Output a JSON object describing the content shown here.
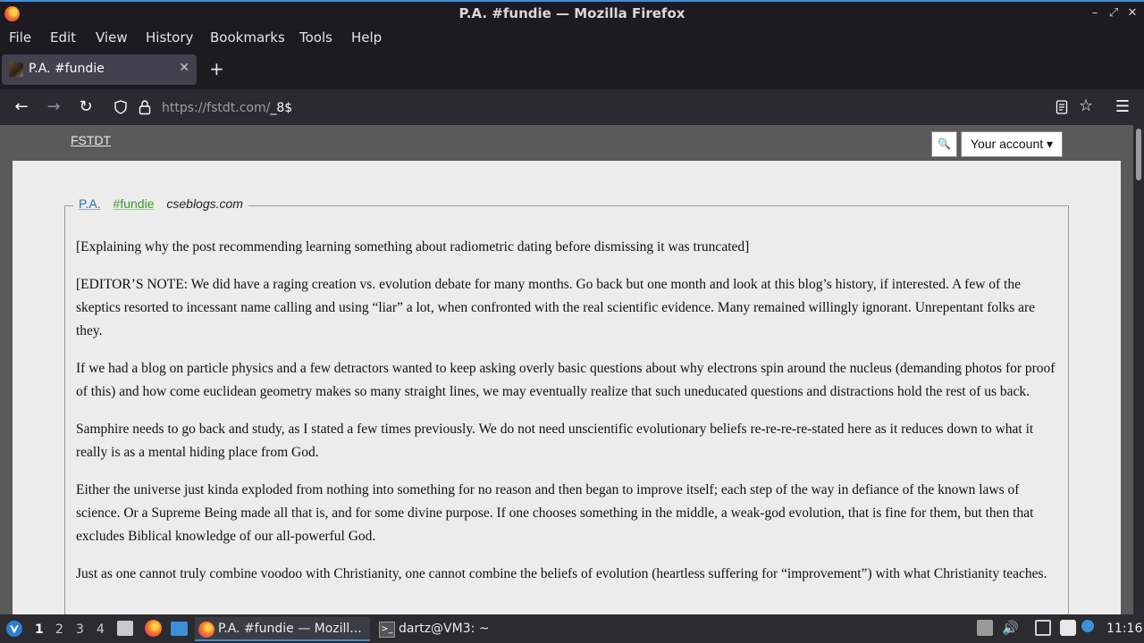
{
  "window": {
    "title": "P.A. #fundie — Mozilla Firefox"
  },
  "menu": [
    "File",
    "Edit",
    "View",
    "History",
    "Bookmarks",
    "Tools",
    "Help"
  ],
  "tab": {
    "title": "P.A. #fundie"
  },
  "url": {
    "host": "https://fstdt.com/",
    "path": "_8$"
  },
  "site": {
    "logo": "FSTDT",
    "account_label": "Your account ▾"
  },
  "quote": {
    "author": "P.A.",
    "tag": "#fundie",
    "source": "cseblogs.com",
    "paragraphs": [
      "[Explaining why the post recommending learning something about radiometric dating before dismissing it was truncated]",
      "[EDITOR’S NOTE: We did have a raging creation vs. evolution debate for many months. Go back but one month and look at this blog’s history, if interested. A few of the skeptics resorted to incessant name calling and using “liar” a lot, when confronted with the real scientific evidence. Many remained willingly ignorant. Unrepentant folks are they.",
      "If we had a blog on particle physics and a few detractors wanted to keep asking overly basic questions about why electrons spin around the nucleus (demanding photos for proof of this) and how come euclidean geometry makes so many straight lines, we may eventually realize that such uneducated questions and distractions hold the rest of us back.",
      "Samphire needs to go back and study, as I stated a few times previously. We do not need unscientific evolutionary beliefs re-re-re-re-stated here as it reduces down to what it really is as a mental hiding place from God.",
      "Either the universe just kinda exploded from nothing into something for no reason and then began to improve itself; each step of the way in defiance of the known laws of science. Or a Supreme Being made all that is, and for some divine purpose. If one chooses something in the middle, a weak-god evolution, that is fine for them, but then that excludes Biblical knowledge of our all-powerful God.",
      "Just as one cannot truly combine voodoo with Christianity, one cannot combine the beliefs of evolution (heartless suffering for “improvement”) with what Christianity teaches."
    ]
  },
  "taskbar": {
    "workspaces": [
      "1",
      "2",
      "3",
      "4"
    ],
    "tasks": [
      {
        "label": "P.A. #fundie — Mozill..."
      },
      {
        "label": "dartz@VM3: ~"
      }
    ],
    "clock": "11:16"
  }
}
